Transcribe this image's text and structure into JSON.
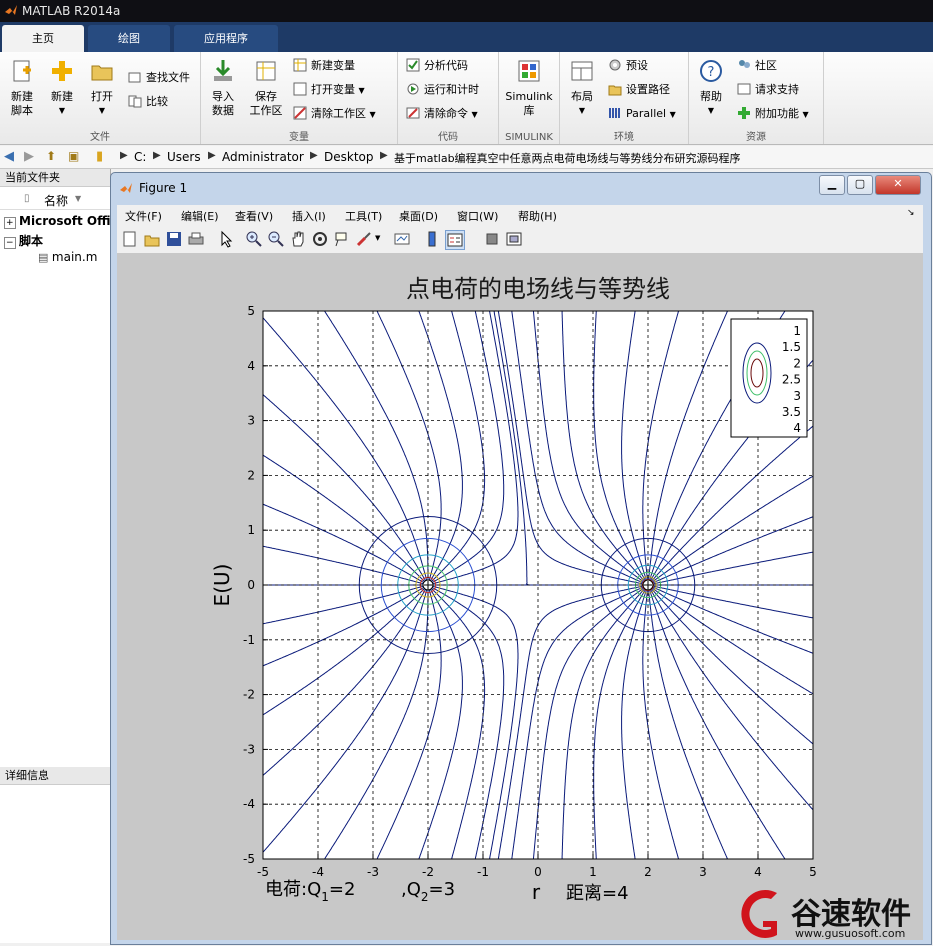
{
  "app": {
    "title": "MATLAB R2014a"
  },
  "tabs": [
    {
      "label": "主页"
    },
    {
      "label": "绘图"
    },
    {
      "label": "应用程序"
    }
  ],
  "ribbon": {
    "file": {
      "label": "文件",
      "new_script": "新建\n脚本",
      "new": "新建",
      "open": "打开",
      "find_files": "查找文件",
      "compare": "比较"
    },
    "variable": {
      "label": "变量",
      "import": "导入\n数据",
      "save_ws": "保存\n工作区",
      "new_var": "新建变量",
      "open_var": "打开变量",
      "clear_ws": "清除工作区"
    },
    "code": {
      "label": "代码",
      "analyze": "分析代码",
      "run_time": "运行和计时",
      "clear_cmd": "清除命令"
    },
    "simulink": {
      "label": "SIMULINK",
      "lib": "Simulink\n库"
    },
    "env": {
      "label": "环境",
      "layout": "布局",
      "prefs": "预设",
      "set_path": "设置路径",
      "parallel": "Parallel"
    },
    "resources": {
      "label": "资源",
      "help": "帮助",
      "community": "社区",
      "support": "请求支持",
      "addons": "附加功能"
    }
  },
  "path": [
    "C:",
    "Users",
    "Administrator",
    "Desktop",
    "基于matlab编程真空中任意两点电荷电场线与等势线分布研究源码程序"
  ],
  "left_panel": {
    "title": "当前文件夹",
    "col_name": "名称",
    "items": [
      {
        "label": "Microsoft Offic"
      },
      {
        "label": "脚本"
      },
      {
        "label": "main.m"
      }
    ],
    "details_title": "详细信息"
  },
  "figure": {
    "title": "Figure 1",
    "menu": [
      "文件(F)",
      "编辑(E)",
      "查看(V)",
      "插入(I)",
      "工具(T)",
      "桌面(D)",
      "窗口(W)",
      "帮助(H)"
    ]
  },
  "chart_data": {
    "type": "line",
    "title": "点电荷的电场线与等势线",
    "xlabel": "r",
    "ylabel": "E(U)",
    "xlim": [
      -5,
      5
    ],
    "ylim": [
      -5,
      5
    ],
    "xticks": [
      "-5",
      "-4",
      "-3",
      "-2",
      "-1",
      "0",
      "1",
      "2",
      "3",
      "4",
      "5"
    ],
    "yticks": [
      "5",
      "4",
      "3",
      "2",
      "1",
      "0",
      "-1",
      "-2",
      "-3",
      "-4",
      "-5"
    ],
    "grid": true,
    "grid_style": "dashed",
    "legend_position": "top-right",
    "legend": [
      "1",
      "1.5",
      "2",
      "2.5",
      "3",
      "3.5",
      "4"
    ],
    "charges": [
      {
        "x": -2,
        "y": 0,
        "q": 2
      },
      {
        "x": 2,
        "y": 0,
        "q": 3
      }
    ],
    "field_line_color": "#0a1a7a",
    "equipotential_colors": [
      "#0a1a7a",
      "#2b4fd0",
      "#22a0c8",
      "#3fbf6a",
      "#c8b020",
      "#d03020",
      "#6a0a0a"
    ],
    "annotations": {
      "charge_text_prefix": "电荷:Q",
      "q1_sub": "1",
      "q1_val": "=2",
      "q2_prefix": ",Q",
      "q2_sub": "2",
      "q2_val": "=3",
      "distance": "距离=4"
    }
  },
  "watermark": {
    "brand": "谷速软件",
    "url": "www.gusuosoft.com",
    "color": "#d0141c"
  }
}
